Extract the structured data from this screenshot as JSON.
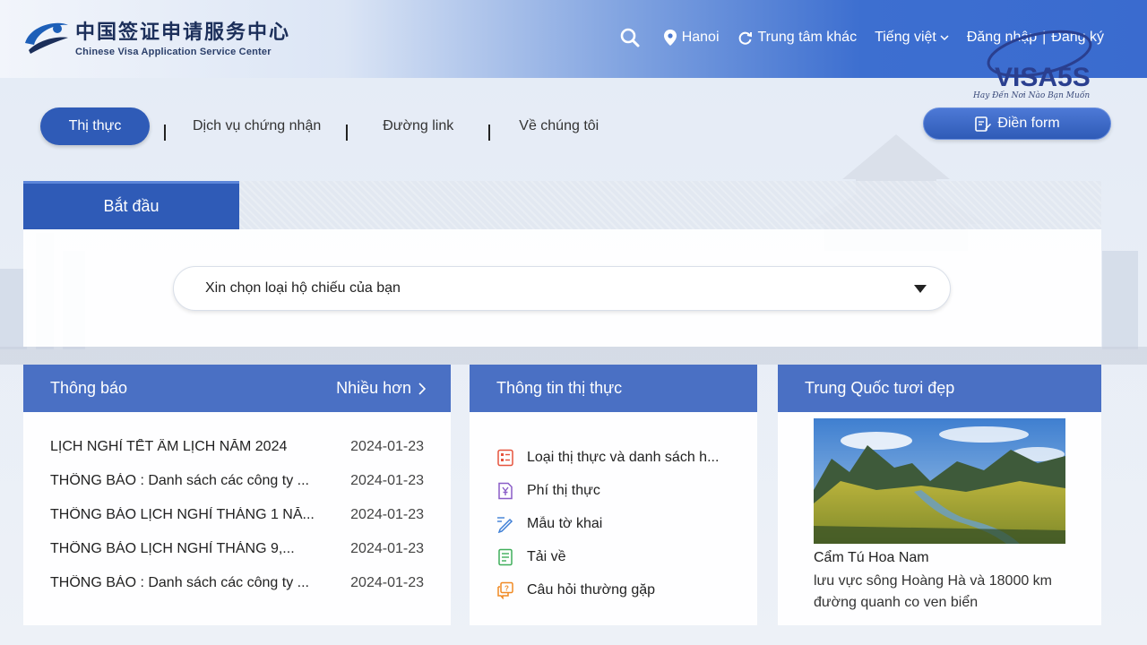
{
  "header": {
    "logo_cn": "中国签证申请服务中心",
    "logo_en": "Chinese Visa Application Service Center",
    "location": "Hanoi",
    "other_center": "Trung tâm khác",
    "language": "Tiếng việt",
    "login": "Đăng nhập",
    "separator": "|",
    "register": "Đăng ký"
  },
  "watermark": {
    "text": "VISA5S",
    "tagline": "Hay Đến Nơi Nào Bạn Muốn"
  },
  "main_nav": {
    "tabs": [
      {
        "label": "Thị thực",
        "active": true
      },
      {
        "label": "Dịch vụ chứng nhận"
      },
      {
        "label": "Đường link"
      },
      {
        "label": "Về chúng tôi"
      }
    ],
    "fill_form": "Điền form"
  },
  "start": {
    "tab_label": "Bắt đầu",
    "select_placeholder": "Xin chọn loại hộ chiếu của bạn"
  },
  "notice": {
    "title": "Thông báo",
    "more": "Nhiều hơn",
    "items": [
      {
        "title": "LỊCH NGHỈ TẾT ÂM LỊCH NĂM 2024",
        "date": "2024-01-23"
      },
      {
        "title": "THÔNG BÁO : Danh sách các công ty ...",
        "date": "2024-01-23"
      },
      {
        "title": "THÔNG BÁO LỊCH NGHỈ THÁNG 1 NĂ...",
        "date": "2024-01-23"
      },
      {
        "title": "THÔNG BÁO LỊCH NGHỈ THÁNG 9,...",
        "date": "2024-01-23"
      },
      {
        "title": "THÔNG BÁO : Danh sách các công ty ...",
        "date": "2024-01-23"
      }
    ]
  },
  "visa_info": {
    "title": "Thông tin thị thực",
    "items": [
      {
        "label": "Loại thị thực và danh sách h...",
        "icon": "list-icon"
      },
      {
        "label": "Phí thị thực",
        "icon": "yen-doc-icon"
      },
      {
        "label": "Mẫu tờ khai",
        "icon": "pen-icon"
      },
      {
        "label": "Tải về",
        "icon": "download-doc-icon"
      },
      {
        "label": "Câu hỏi thường gặp",
        "icon": "faq-icon"
      }
    ]
  },
  "china": {
    "title": "Trung Quốc tươi đẹp",
    "image_title": "Cẩm Tú Hoa Nam",
    "description": "lưu vực sông Hoàng Hà và 18000 km đường quanh co ven biển"
  },
  "colors": {
    "primary": "#2f5bb7",
    "card_header": "#4a70c4",
    "icon_red": "#e5533d",
    "icon_purple": "#8a5cc7",
    "icon_blue": "#3f7fd6",
    "icon_green": "#3fae5b",
    "icon_orange": "#f08a24"
  }
}
